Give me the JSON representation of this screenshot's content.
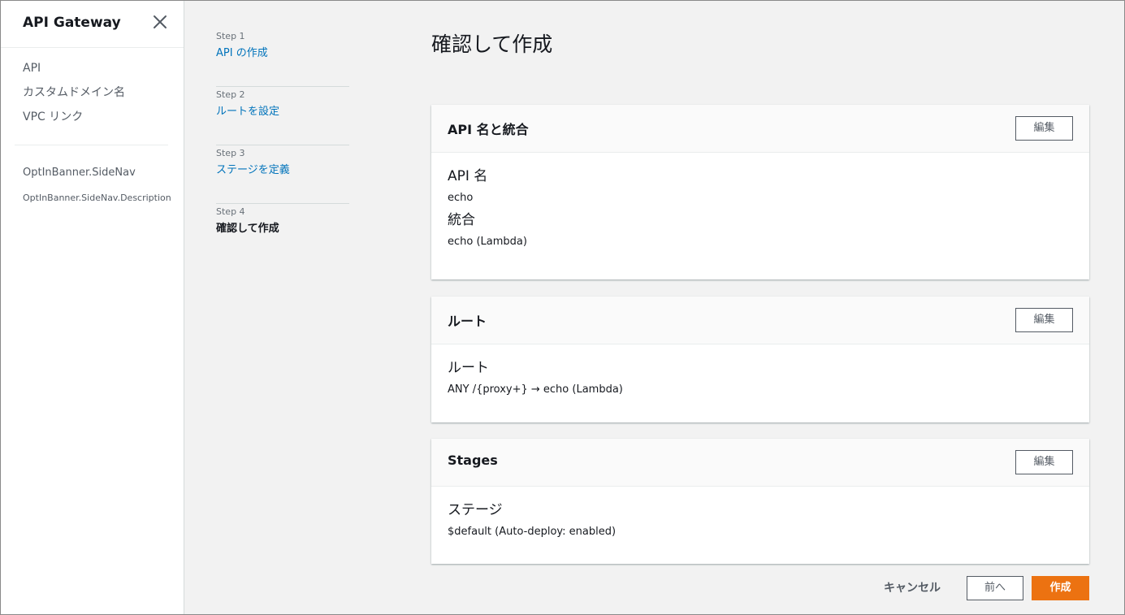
{
  "sidenav": {
    "title": "API Gateway",
    "close_icon": "close-icon",
    "items": [
      {
        "label": "API"
      },
      {
        "label": "カスタムドメイン名"
      },
      {
        "label": "VPC リンク"
      }
    ],
    "optin_title": "OptInBanner.SideNav",
    "optin_description": "OptInBanner.SideNav.Description"
  },
  "steps": [
    {
      "num": "Step 1",
      "label": "API の作成",
      "current": false
    },
    {
      "num": "Step 2",
      "label": "ルートを設定",
      "current": false
    },
    {
      "num": "Step 3",
      "label": "ステージを定義",
      "current": false
    },
    {
      "num": "Step 4",
      "label": "確認して作成",
      "current": true
    }
  ],
  "page_title": "確認して作成",
  "panels": {
    "api": {
      "title": "API 名と統合",
      "edit_label": "編集",
      "fields": [
        {
          "label": "API 名",
          "value": "echo"
        },
        {
          "label": "統合",
          "value": "echo (Lambda)"
        }
      ]
    },
    "routes": {
      "title": "ルート",
      "edit_label": "編集",
      "fields": [
        {
          "label": "ルート",
          "value": "ANY /{proxy+} → echo (Lambda)"
        }
      ]
    },
    "stages": {
      "title": "Stages",
      "edit_label": "編集",
      "fields": [
        {
          "label": "ステージ",
          "value": "$default (Auto-deploy: enabled)"
        }
      ]
    }
  },
  "footer": {
    "cancel_label": "キャンセル",
    "prev_label": "前へ",
    "create_label": "作成"
  },
  "colors": {
    "link": "#0073bb",
    "primary_button": "#ec7211",
    "text": "#16191f",
    "muted": "#545b64"
  }
}
